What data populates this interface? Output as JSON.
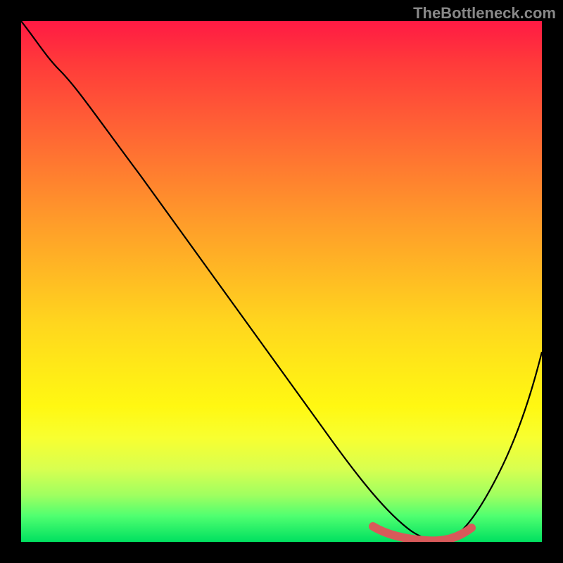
{
  "watermark": "TheBottleneck.com",
  "chart_data": {
    "type": "line",
    "title": "",
    "xlabel": "",
    "ylabel": "",
    "xlim": [
      0,
      100
    ],
    "ylim": [
      0,
      100
    ],
    "grid": false,
    "legend": false,
    "series": [
      {
        "name": "bottleneck-curve",
        "x": [
          0,
          3,
          8,
          15,
          25,
          35,
          45,
          55,
          62,
          67,
          70,
          73,
          76,
          79,
          82,
          86,
          90,
          95,
          100
        ],
        "y": [
          100,
          97,
          91,
          82,
          69,
          56,
          43,
          30,
          20,
          12,
          7,
          3,
          1,
          0,
          1,
          5,
          13,
          25,
          40
        ],
        "color": "#000000"
      },
      {
        "name": "optimal-zone-marker",
        "x": [
          67,
          70,
          73,
          76,
          79,
          82,
          84
        ],
        "y": [
          4,
          2,
          1,
          0,
          0,
          1,
          3
        ],
        "color": "#d85a5a"
      }
    ]
  }
}
